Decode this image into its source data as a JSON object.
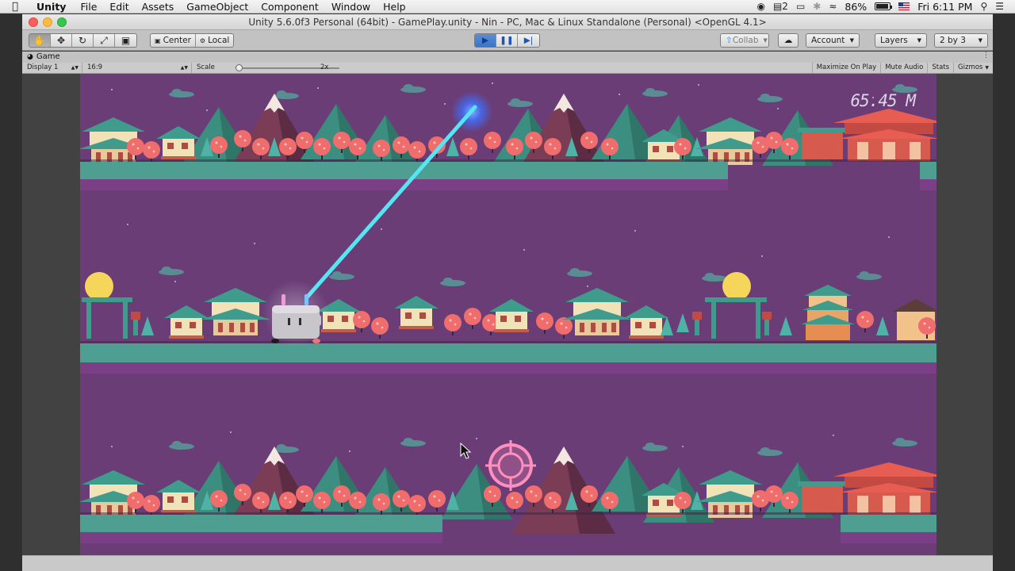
{
  "menubar": {
    "app": "Unity",
    "items": [
      "File",
      "Edit",
      "Assets",
      "GameObject",
      "Component",
      "Window",
      "Help"
    ],
    "status": {
      "notifications": "2",
      "battery": "86%",
      "clock": "Fri 6:11 PM"
    }
  },
  "window": {
    "title": "Unity 5.6.0f3 Personal (64bit) - GamePlay.unity - Nin - PC, Mac & Linux Standalone (Personal) <OpenGL 4.1>"
  },
  "toolbar": {
    "pivot_center": "Center",
    "pivot_local": "Local",
    "collab": "Collab",
    "account": "Account",
    "layers": "Layers",
    "layout": "2 by 3"
  },
  "tab": {
    "label": "Game"
  },
  "gamebar": {
    "display": "Display 1",
    "aspect": "16:9",
    "scale_label": "Scale",
    "scale_value": "2x",
    "maximize": "Maximize On Play",
    "mute": "Mute Audio",
    "stats": "Stats",
    "gizmos": "Gizmos"
  },
  "game": {
    "distance": "65.45 M"
  },
  "colors": {
    "sky": "#6a3d77",
    "ground": "#4e9f92",
    "ground_shadow": "#7b3f86",
    "laser": "#55e6f2",
    "target": "#ff8fbd"
  }
}
